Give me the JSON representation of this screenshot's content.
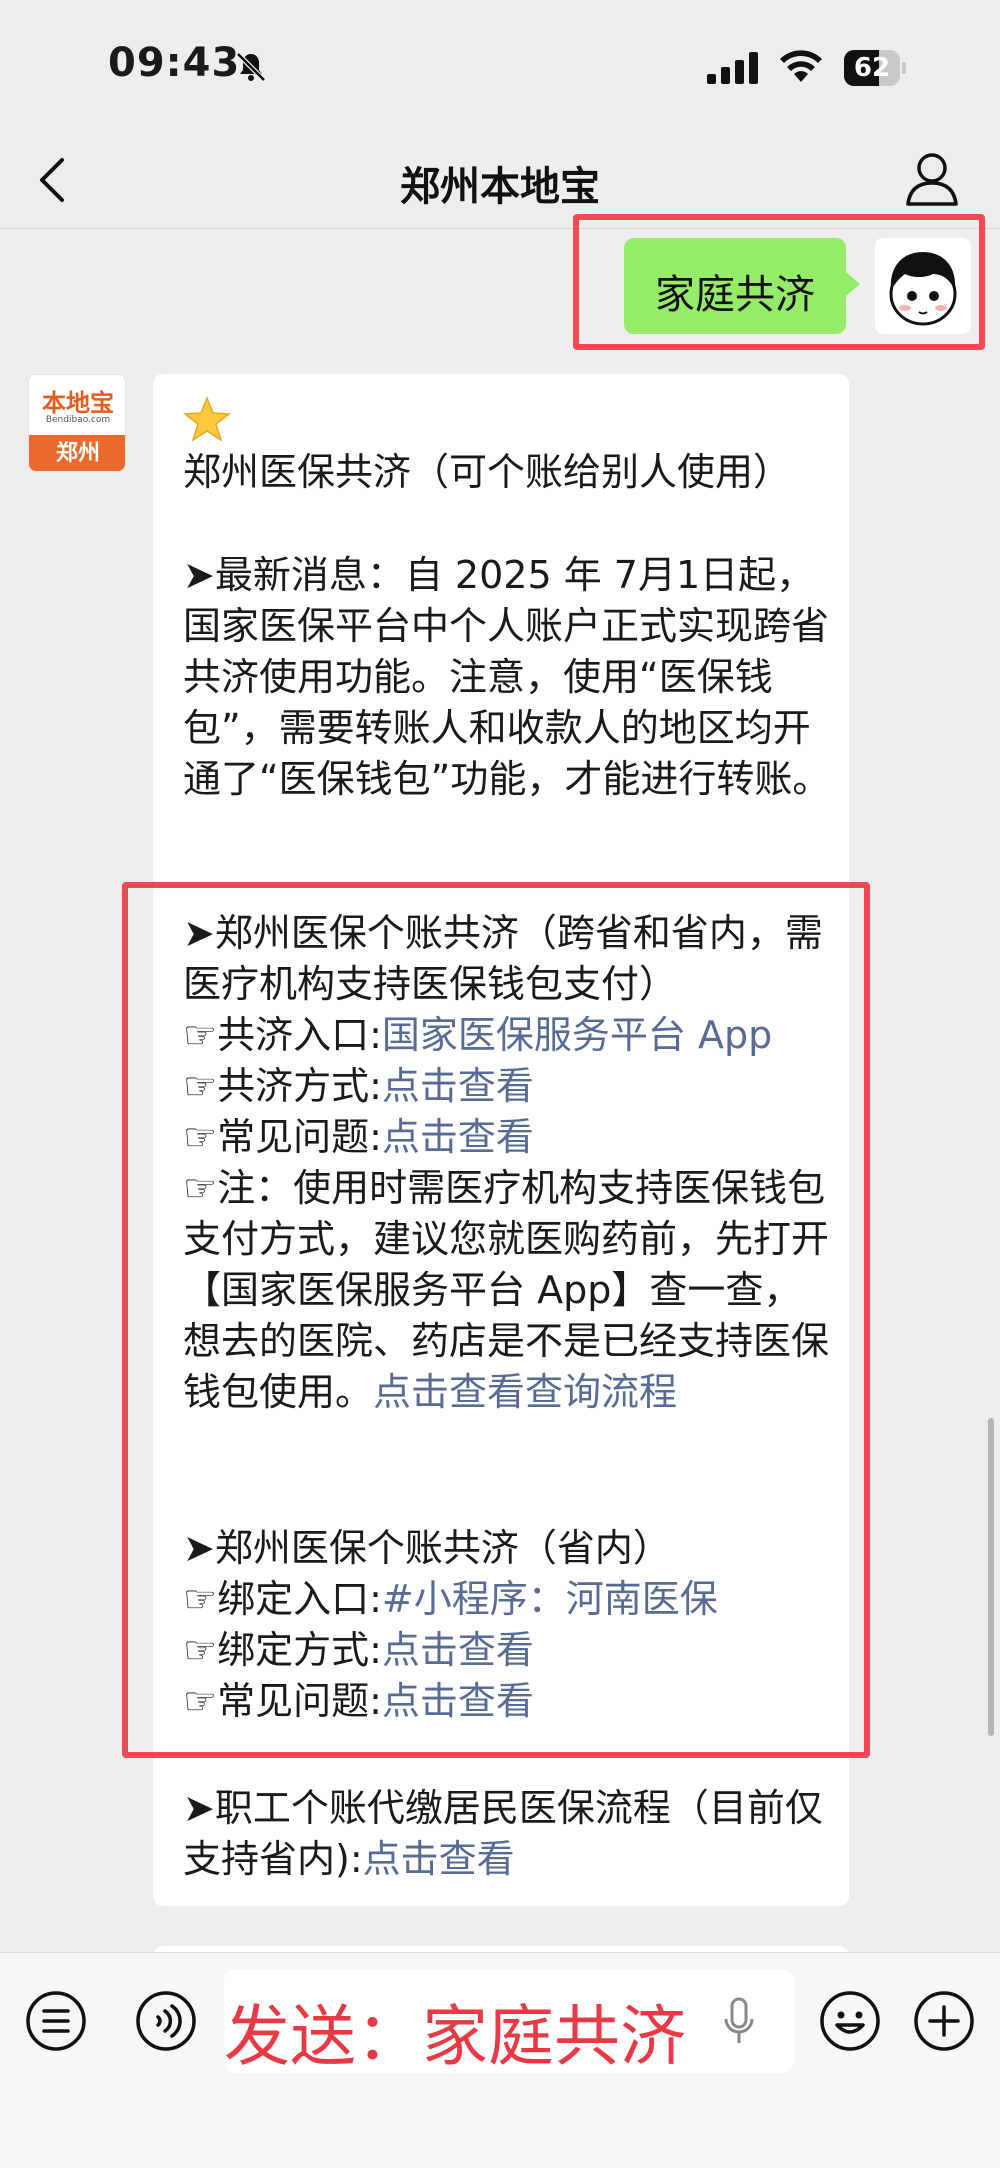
{
  "status_bar": {
    "time": "09:43",
    "battery": "62",
    "battery_level": 0.62
  },
  "nav": {
    "title": "郑州本地宝"
  },
  "sent_message": {
    "text": "家庭共济"
  },
  "brand_avatar": {
    "logo_text": "本地宝",
    "url_text": "Bendibao.com",
    "city": "郑州"
  },
  "reply": {
    "title": "郑州医保共济（可个账给别人使用）",
    "news_1": "➤最新消息：自 2025 年 7月1日起，国家医保平台中个人账户正式实现跨省共济使用功能。注意，使用“医保钱包”，需要转账人和收款人的地区均开通了“医保钱包”功能，才能进行转账。",
    "s1_heading": "➤郑州医保个账共济（跨省和省内，需医疗机构支持医保钱包支付）",
    "s1_entry_label": "☞共济入口:",
    "s1_entry_link": "国家医保服务平台 App",
    "s1_method_label": "☞共济方式:",
    "s1_method_link": "点击查看",
    "s1_faq_label": "☞常见问题:",
    "s1_faq_link": "点击查看",
    "s1_note": "☞注：使用时需医疗机构支持医保钱包支付方式，建议您就医购药前，先打开【国家医保服务平台 App】查一查，想去的医院、药店是不是已经支持医保钱包使用。",
    "s1_note_link": "点击查看查询流程",
    "s2_heading": "➤郑州医保个账共济（省内）",
    "s2_entry_label": "☞绑定入口:",
    "s2_entry_link": "#小程序：河南医保",
    "s2_method_label": "☞绑定方式:",
    "s2_method_link": "点击查看",
    "s2_faq_label": "☞常见问题:",
    "s2_faq_link": "点击查看",
    "s3_text": "➤职工个账代缴居民医保流程（目前仅支持省内):",
    "s3_link": "点击查看"
  },
  "input_bar": {
    "text": "发送：家庭共济"
  },
  "icons": {
    "back": "chevron-left-icon",
    "profile": "person-icon",
    "list": "list-icon",
    "voice": "voice-icon",
    "emoji": "emoji-icon",
    "plus": "plus-icon",
    "mic": "mic-icon"
  },
  "colors": {
    "link": "#576b95",
    "sent_bubble": "#95ec69",
    "annotation": "#f04b55"
  }
}
